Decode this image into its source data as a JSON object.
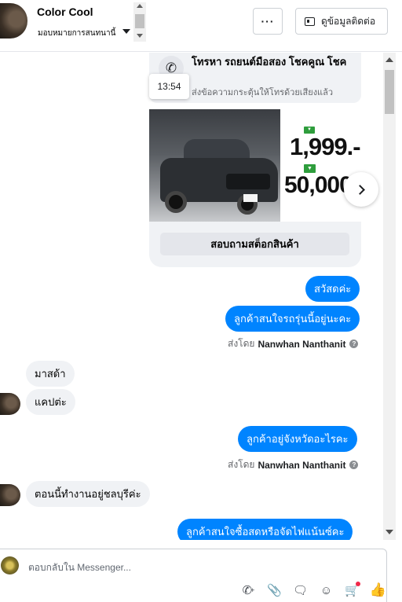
{
  "header": {
    "contact_name": "Color Cool",
    "assign_label": "มอบหมายการสนทนานี้",
    "more_label": "···",
    "view_contact_label": "ดูข้อมูลติดต่อ"
  },
  "thread": {
    "call_card": {
      "title": "โทรหา รถยนต์มือสอง โชคคูณ โชค",
      "subtitle": "ส่งข้อความกระตุ้นให้โทรด้วยเสียงแล้ว",
      "time_tooltip": "13:54"
    },
    "product_card": {
      "promo_price": "1,999.-",
      "promo_discount": "50,000",
      "stock_button_label": "สอบถามสต็อกสินค้า"
    },
    "messages": [
      {
        "direction": "out",
        "text": "สวัสดค่ะ"
      },
      {
        "direction": "out",
        "text": "ลูกค้าสนใจรถรุ่นนี้อยู่นะคะ"
      },
      {
        "direction": "in",
        "text": "มาสด้า"
      },
      {
        "direction": "in",
        "text": "แคปต่ะ"
      },
      {
        "direction": "out",
        "text": "ลูกค้าอยู่จังหวัดอะไรคะ"
      },
      {
        "direction": "in",
        "text": "ตอนนี้ทำงานอยู่ชลบุรีค่ะ"
      },
      {
        "direction": "out",
        "text": "ลูกค้าสนใจซื้อสดหรือจัดไฟแน้นซ์คะ"
      }
    ],
    "sent_by_label": "ส่งโดย",
    "sent_by_name": "Nanwhan Nanthanit"
  },
  "composer": {
    "placeholder": "ตอบกลับใน Messenger...",
    "tools": [
      "add-call-icon",
      "attach-icon",
      "saved-replies-icon",
      "emoji-icon",
      "cart-icon",
      "like-icon"
    ]
  },
  "colors": {
    "outgoing_bubble": "#0084ff",
    "incoming_bubble": "#f0f2f5",
    "promo_green": "#2e9d3c"
  }
}
